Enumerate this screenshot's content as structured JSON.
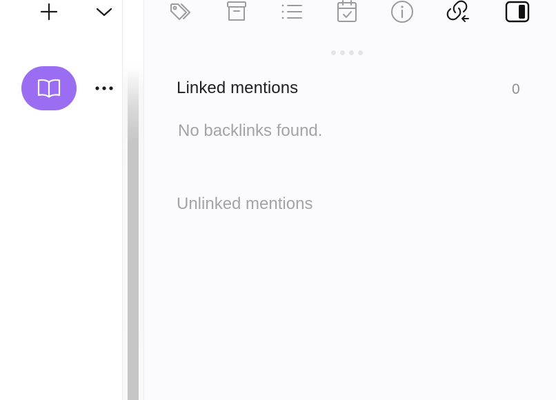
{
  "toolbar": {
    "left_icons": [
      "plus-icon",
      "chevron-down-icon"
    ],
    "right_icons": [
      "tags-icon",
      "archive-icon",
      "list-icon",
      "calendar-check-icon",
      "info-icon",
      "link-backlinks-icon",
      "sidebar-toggle-icon"
    ]
  },
  "left_panel": {
    "reader_icon": "book-open-icon",
    "more_icon": "more-horizontal-icon",
    "accent_color": "#9b6df2"
  },
  "backlinks": {
    "linked_title": "Linked mentions",
    "linked_count": "0",
    "empty_message": "No backlinks found.",
    "unlinked_title": "Unlinked mentions"
  }
}
